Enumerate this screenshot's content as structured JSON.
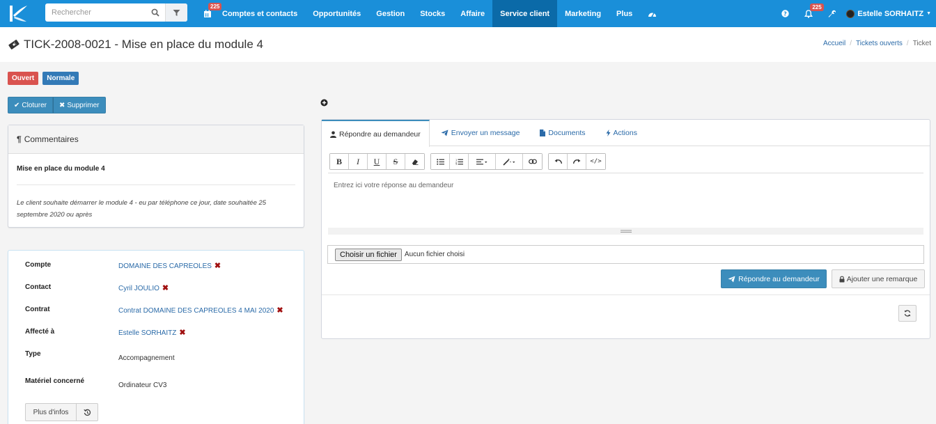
{
  "search": {
    "placeholder": "Rechercher"
  },
  "nav": {
    "calendar_badge": "225",
    "items": [
      "Comptes et contacts",
      "Opportunités",
      "Gestion",
      "Stocks",
      "Affaire",
      "Service client",
      "Marketing",
      "Plus"
    ],
    "active_index": 5,
    "notifications_badge": "225",
    "user_name": "Estelle SORHAITZ"
  },
  "header": {
    "title": "TICK-2008-0021 - Mise en place du module 4",
    "breadcrumb": [
      "Accueil",
      "Tickets ouverts",
      "Ticket"
    ]
  },
  "labels": {
    "status": "Ouvert",
    "priority": "Normale"
  },
  "actions": {
    "close": "Cloturer",
    "delete": "Supprimer"
  },
  "comments": {
    "heading": "Commentaires",
    "title": "Mise en place du module 4",
    "text": "Le client souhaite démarrer le module 4 - eu par téléphone ce jour, date souhaitée 25 septembre 2020 ou après"
  },
  "info": {
    "rows": [
      {
        "key": "Compte",
        "value": "DOMAINE DES CAPREOLES",
        "link": true
      },
      {
        "key": "Contact",
        "value": "Cyril JOULIO",
        "link": true
      },
      {
        "key": "Contrat",
        "value": "Contrat DOMAINE DES CAPREOLES 4 MAI 2020",
        "link": true
      },
      {
        "key": "Affecté à",
        "value": "Estelle SORHAITZ",
        "link": true
      },
      {
        "key": "Type",
        "value": "Accompagnement",
        "link": false
      },
      {
        "key": "Matériel concerné",
        "value": "Ordinateur CV3",
        "link": false
      }
    ],
    "more_label": "Plus d'infos"
  },
  "tabs": [
    "Répondre au demandeur",
    "Envoyer un message",
    "Documents",
    "Actions"
  ],
  "editor": {
    "placeholder": "Entrez ici votre réponse au demandeur",
    "file_button": "Choisir un fichier",
    "file_status": "Aucun fichier choisi",
    "reply_button": "Répondre au demandeur",
    "note_button": "Ajouter une remarque"
  },
  "colors": {
    "navbar": "#1a8fd9",
    "navbar_active": "#0b6aa8",
    "primary": "#3c8dbc",
    "danger": "#d9534f",
    "label_blue": "#337ab7"
  }
}
